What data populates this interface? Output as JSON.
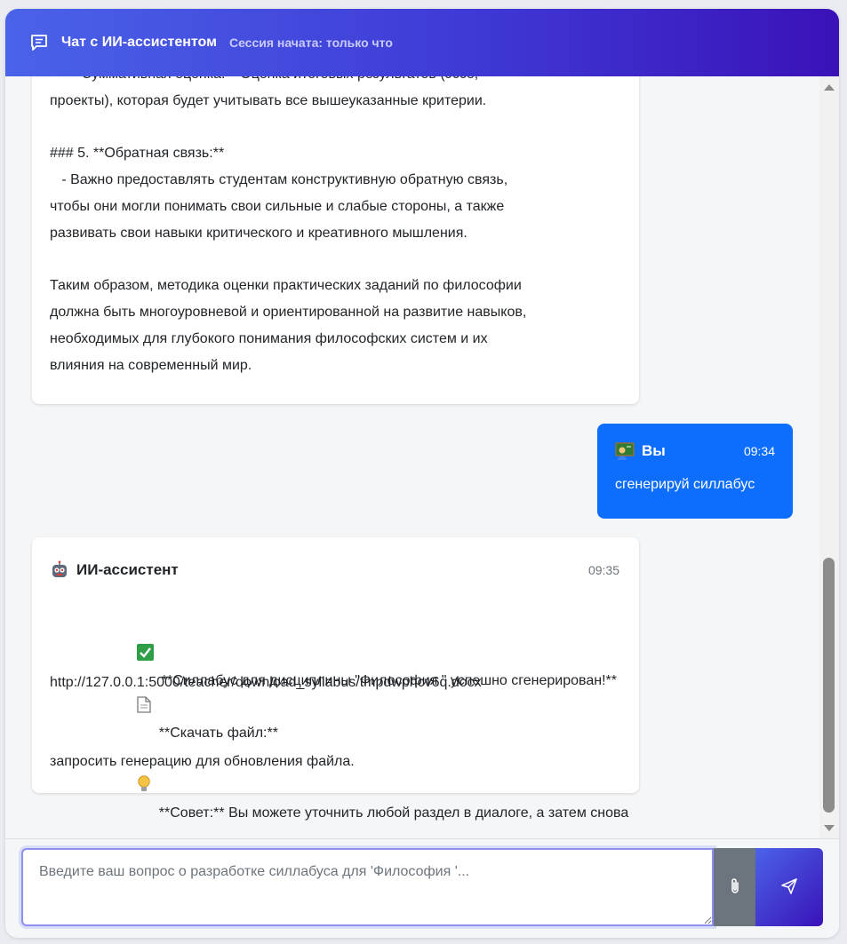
{
  "header": {
    "title": "Чат с ИИ-ассистентом",
    "session": "Сессия начата: только что",
    "icon": "chat-icon"
  },
  "messages": [
    {
      "role": "assistant",
      "lines": [
        "   - **Суммативная оценка:** Оценка итоговых результатов (эссе,",
        "проекты), которая будет учитывать все вышеуказанные критерии.",
        "",
        "### 5. **Обратная связь:**",
        "   - Важно предоставлять студентам конструктивную обратную связь,",
        "чтобы они могли понимать свои сильные и слабые стороны, а также",
        "развивать свои навыки критического и креативного мышления.",
        "",
        "Таким образом, методика оценки практических заданий по философии",
        "должна быть многоуровневой и ориентированной на развитие навыков,",
        "необходимых для глубокого понимания философских систем и их",
        "влияния на современный мир."
      ]
    },
    {
      "role": "user",
      "sender": "Вы",
      "avatar_icon": "teacher-avatar-icon",
      "time": "09:34",
      "text": "сгенерируй силлабус"
    },
    {
      "role": "assistant",
      "sender": "ИИ-ассистент",
      "avatar_icon": "robot-avatar-icon",
      "time": "09:35",
      "success_icon": "check-mark-icon",
      "success_text": "**Силлабус для дисциплины \"Философия \" успешно сгенерирован!**",
      "file_icon": "document-icon",
      "download_label": "**Скачать файл:**",
      "download_url": "http://127.0.0.1:5000/teacher/download_syllabus/tmpdwphcv6q.docx",
      "tip_icon": "lightbulb-icon",
      "tip_line1": "**Совет:** Вы можете уточнить любой раздел в диалоге, а затем снова",
      "tip_line2": "запросить генерацию для обновления файла."
    }
  ],
  "input": {
    "placeholder": "Введите ваш вопрос о разработке силлабуса для 'Философия '...",
    "value": ""
  },
  "buttons": {
    "attach_icon": "paperclip-icon",
    "send_icon": "send-icon"
  },
  "colors": {
    "header_start": "#4a63e8",
    "header_end": "#3a12b8",
    "user_bubble": "#0d6efd",
    "attach_button": "#6c757d"
  }
}
